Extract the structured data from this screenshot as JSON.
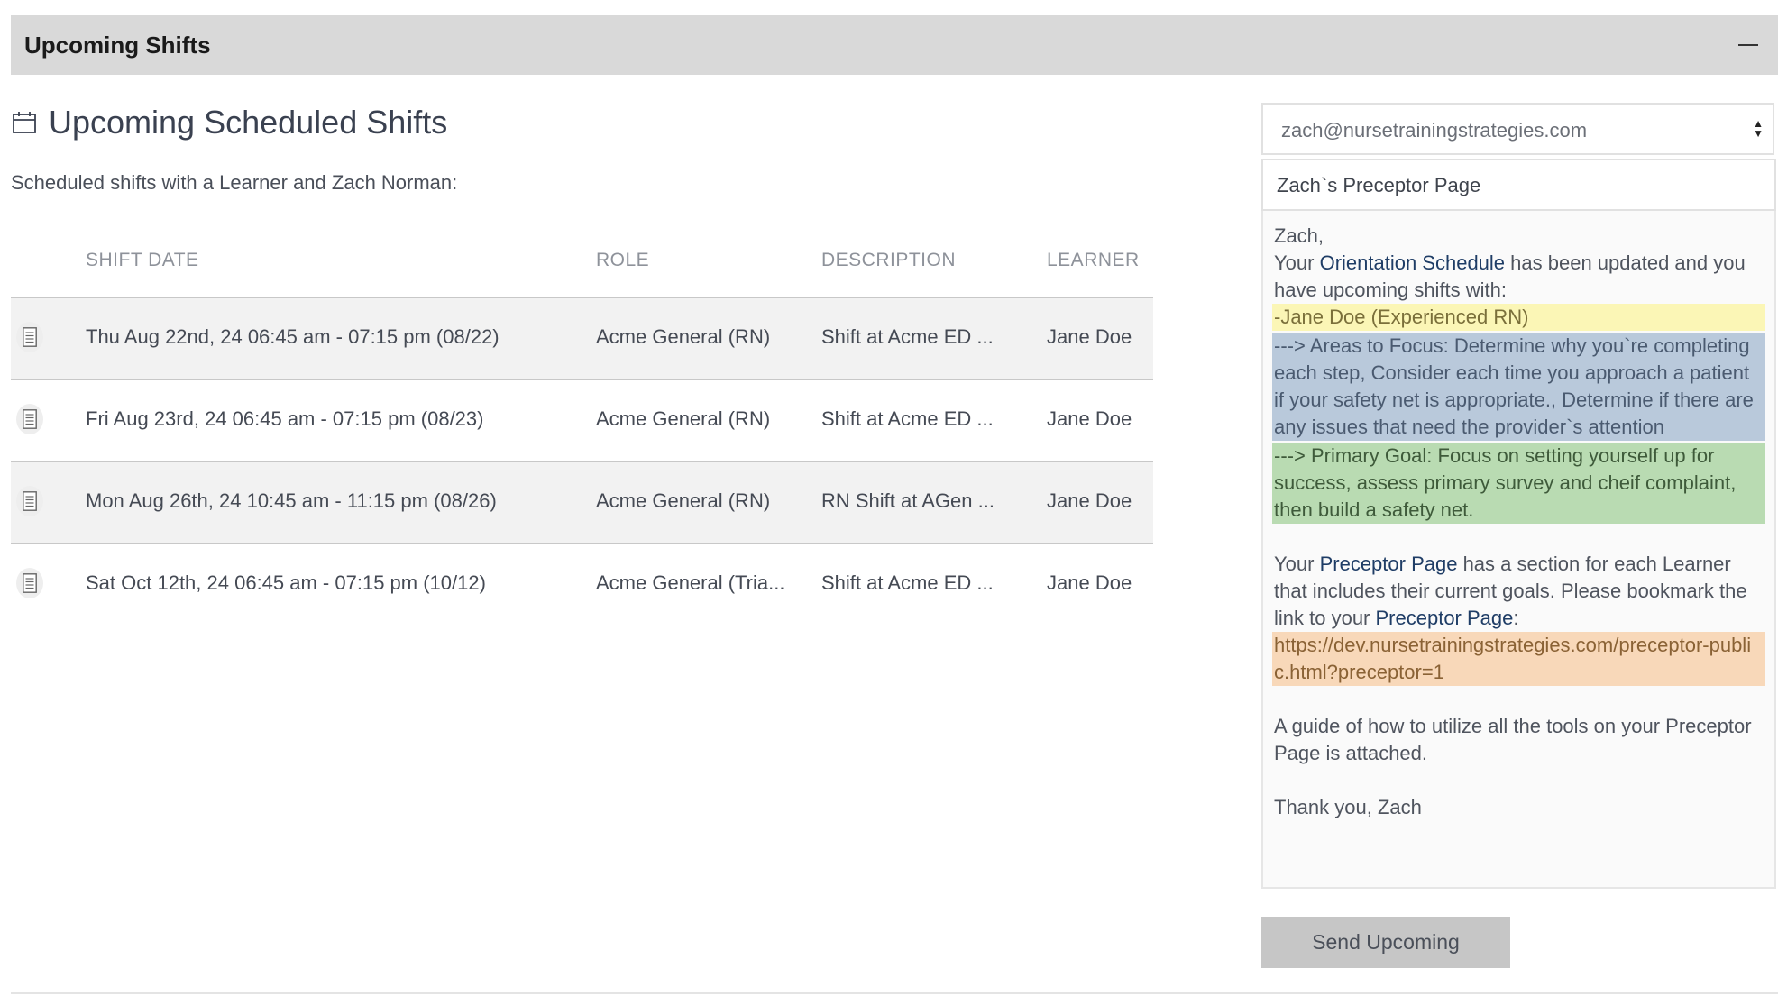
{
  "panel": {
    "title": "Upcoming Shifts",
    "collapse_icon": "minus-icon"
  },
  "section": {
    "icon": "calendar-icon",
    "title": "Upcoming Scheduled Shifts"
  },
  "subtitle": "Scheduled shifts with a Learner and Zach Norman:",
  "table": {
    "headers": {
      "date": "SHIFT DATE",
      "role": "ROLE",
      "description": "DESCRIPTION",
      "learner": "LEARNER"
    },
    "rows": [
      {
        "date": "Thu Aug 22nd, 24 06:45 am - 07:15 pm (08/22)",
        "role": "Acme General (RN)",
        "description": "Shift at Acme ED ...",
        "learner": "Jane Doe"
      },
      {
        "date": "Fri Aug 23rd, 24 06:45 am - 07:15 pm (08/23)",
        "role": "Acme General (RN)",
        "description": "Shift at Acme ED ...",
        "learner": "Jane Doe"
      },
      {
        "date": "Mon Aug 26th, 24 10:45 am - 11:15 pm (08/26)",
        "role": "Acme General (RN)",
        "description": "RN Shift at AGen ...",
        "learner": "Jane Doe"
      },
      {
        "date": "Sat Oct 12th, 24 06:45 am - 07:15 pm (10/12)",
        "role": "Acme General (Tria...",
        "description": "Shift at Acme ED ...",
        "learner": "Jane Doe"
      }
    ]
  },
  "email": {
    "recipient": "zach@nursetrainingstrategies.com",
    "subject": "Zach`s Preceptor Page",
    "message": {
      "greeting": "Zach,",
      "line1_pre": "Your ",
      "line1_link": "Orientation Schedule",
      "line1_post": " has been updated and you have upcoming shifts with:",
      "learner_line": "-Jane Doe (Experienced RN)",
      "focus_line": "---> Areas to Focus: Determine why you`re completing each step, Consider each time you approach a patient if your safety net is appropriate., Determine if there are any issues that need the provider`s attention",
      "goal_line": "---> Primary Goal: Focus on setting yourself up for success, assess primary survey and cheif complaint, then build a safety net.",
      "para2_pre": "Your ",
      "para2_link1": "Preceptor Page",
      "para2_mid": " has a section for each Learner that includes their current goals. Please bookmark the link to your ",
      "para2_link2": "Preceptor Page",
      "para2_post": ":",
      "url": "https://dev.nursetrainingstrategies.com/preceptor-public.html?preceptor=1",
      "guide": "A guide of how to utilize all the tools on your Preceptor Page is attached.",
      "signoff": "Thank you, Zach"
    }
  },
  "send_button": "Send Upcoming",
  "colors": {
    "header_bg": "#d9d9d9",
    "highlight_yellow": "#fbf6b6",
    "highlight_blue": "#b9c9db",
    "highlight_green": "#b9dbb2",
    "highlight_orange": "#f8d8b9",
    "link": "#1f3d66"
  }
}
